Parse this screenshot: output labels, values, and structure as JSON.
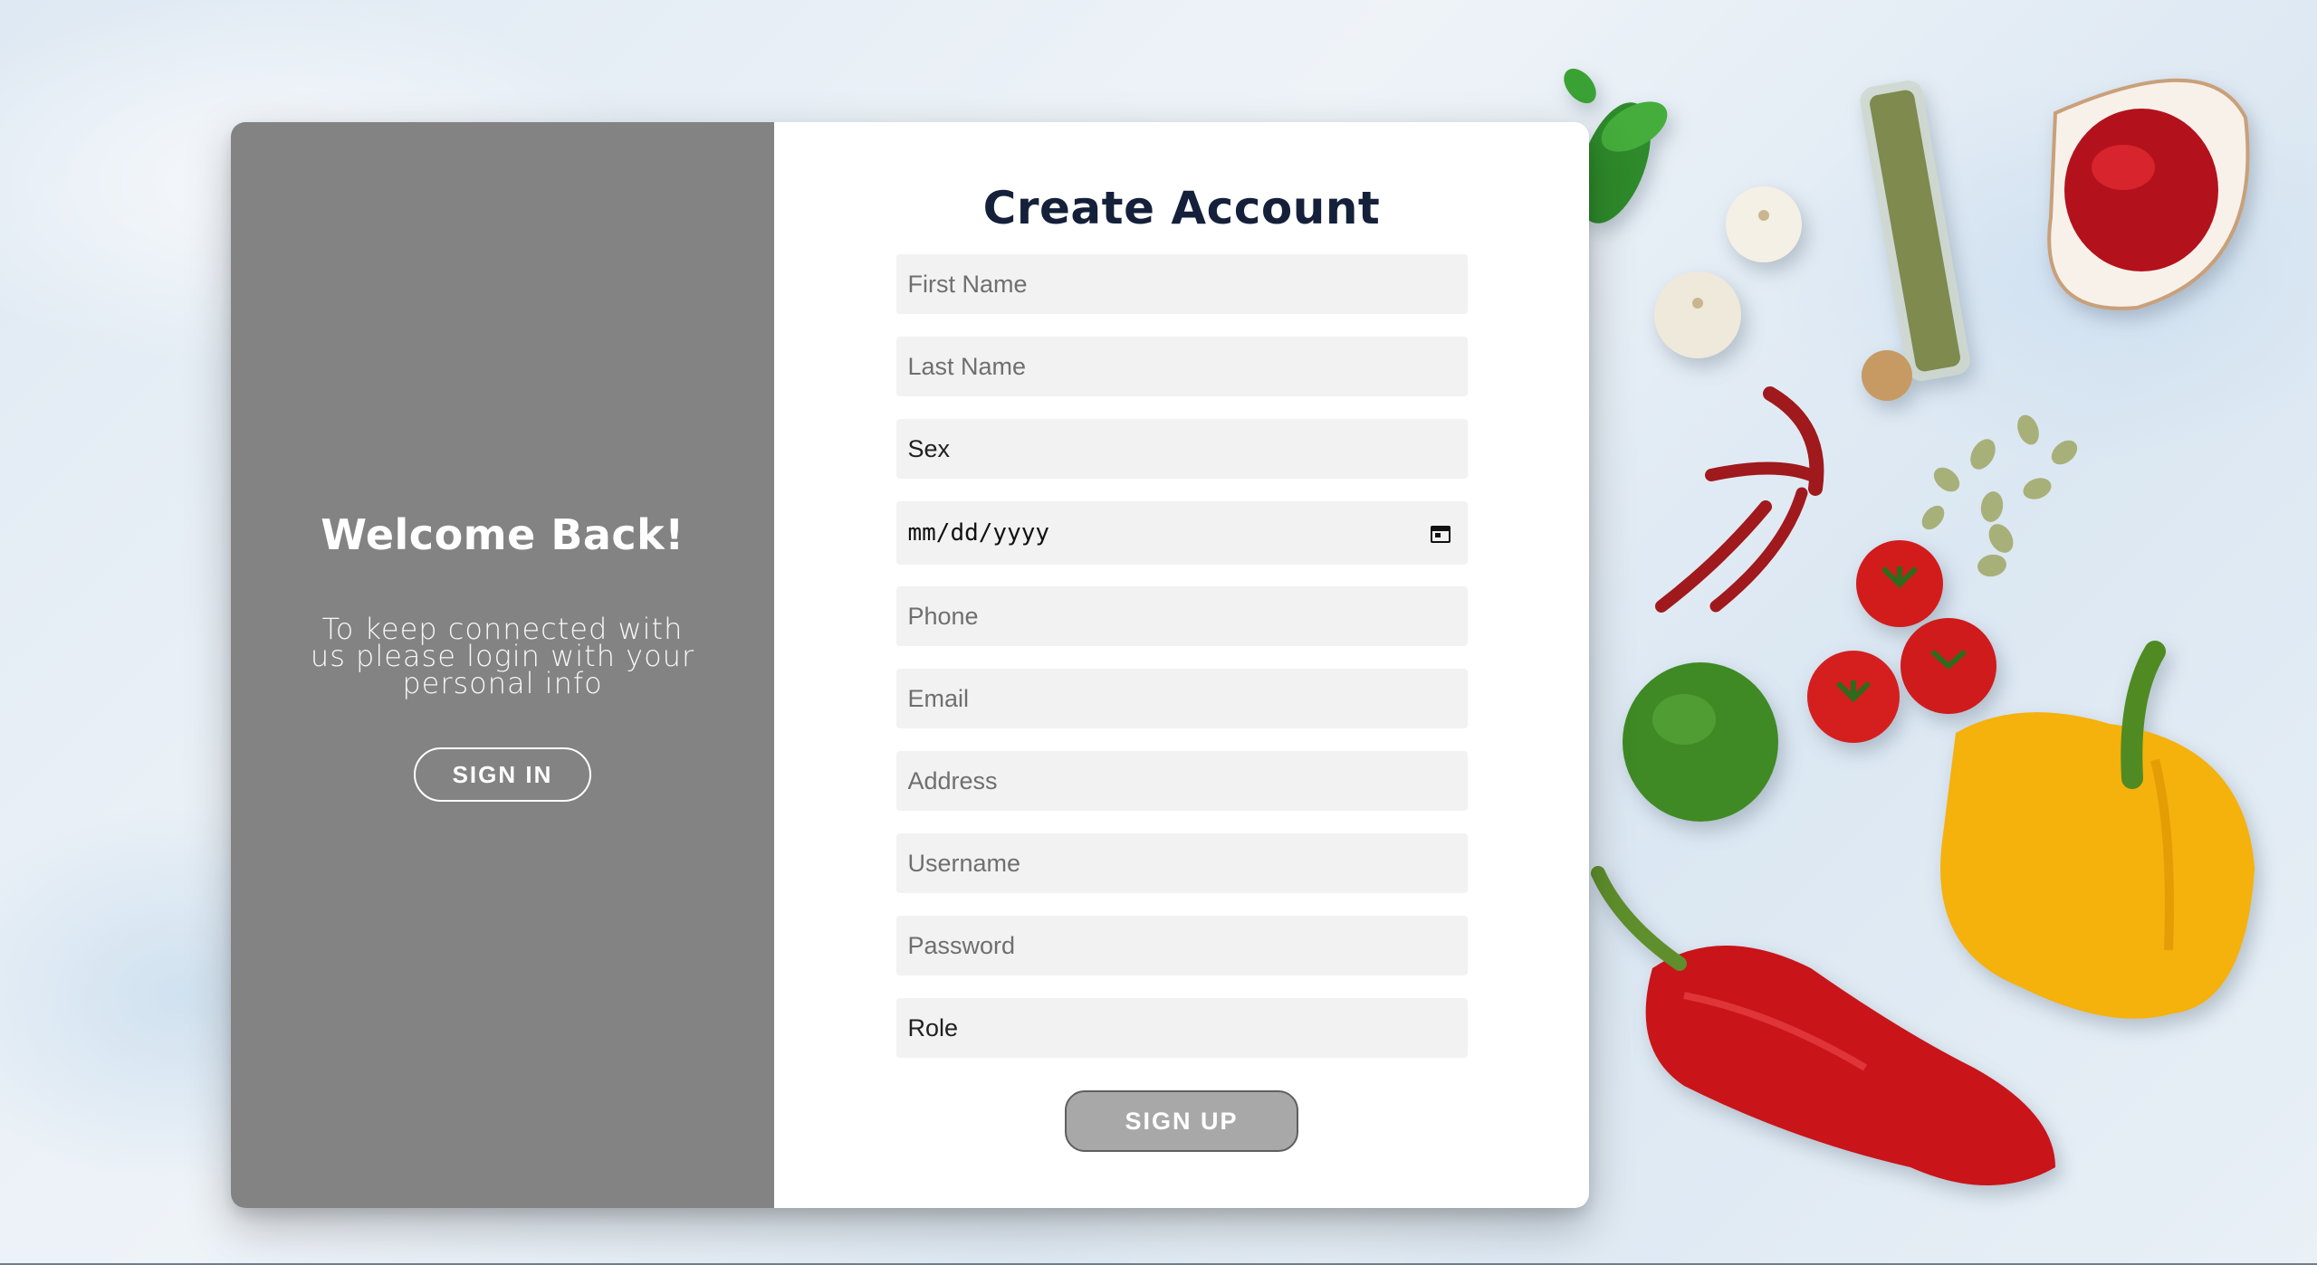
{
  "signin_panel": {
    "heading": "Welcome Back!",
    "message": "To keep connected with us please login with your personal info",
    "signin_button": "SIGN IN"
  },
  "signup_form": {
    "title": "Create Account",
    "first_name_placeholder": "First Name",
    "last_name_placeholder": "Last Name",
    "sex_select_value": "Sex",
    "date_of_birth_placeholder": "mm/dd/yyyy",
    "phone_placeholder": "Phone",
    "email_placeholder": "Email",
    "address_placeholder": "Address",
    "username_placeholder": "Username",
    "password_placeholder": "Password",
    "role_select_value": "Role",
    "signup_button": "SIGN UP"
  },
  "icons": {
    "date_picker": "calendar-icon"
  },
  "colors": {
    "left_panel_bg": "#838383",
    "title_color": "#15203a",
    "field_bg": "#f2f2f2",
    "signup_button_bg": "#a8a8a8"
  }
}
